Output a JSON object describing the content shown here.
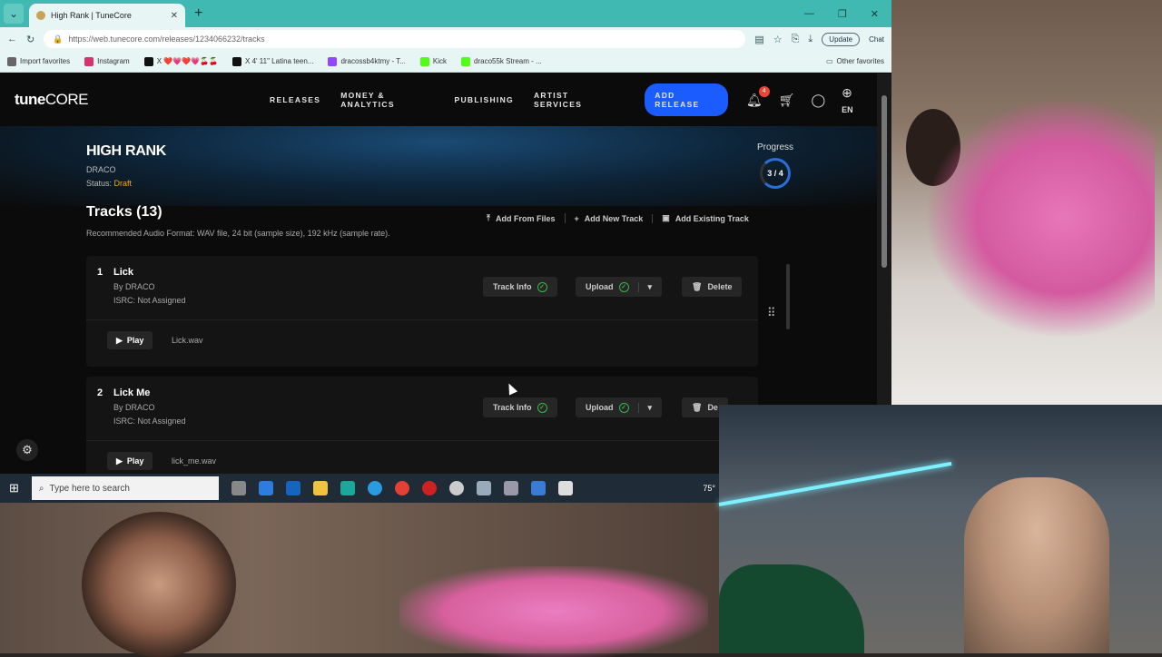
{
  "browser": {
    "tab_title": "High Rank | TuneCore",
    "url": "https://web.tunecore.com/releases/1234066232/tracks",
    "update_label": "Update",
    "chat_label": "Chat",
    "bookmarks": [
      {
        "label": "Import favorites",
        "color": "#666666"
      },
      {
        "label": "Instagram",
        "color": "#d6336c"
      },
      {
        "label": "X ❤️💗❤️💗🍒🍒",
        "color": "#111111"
      },
      {
        "label": "X 4' 11\" Latina teen...",
        "color": "#111111"
      },
      {
        "label": "dracossb4ktmy - T...",
        "color": "#9146ff"
      },
      {
        "label": "Kick",
        "color": "#53fc18"
      },
      {
        "label": "draco55k Stream - ...",
        "color": "#53fc18"
      }
    ],
    "other_favorites": "Other favorites"
  },
  "site": {
    "logo_bold": "tune",
    "logo_rest": "CORE",
    "nav": [
      "RELEASES",
      "MONEY & ANALYTICS",
      "PUBLISHING",
      "ARTIST SERVICES"
    ],
    "add_release": "ADD RELEASE",
    "notif_count": "4",
    "lang": "EN",
    "accent": "#1a5cff"
  },
  "release": {
    "title": "HIGH RANK",
    "artist": "DRACO",
    "status_label": "Status:",
    "status_value": "Draft",
    "progress_label": "Progress",
    "progress_value": "3 / 4"
  },
  "tracks": {
    "heading": "Tracks (13)",
    "recommendation": "Recommended Audio Format: WAV file, 24 bit (sample size), 192 kHz (sample rate).",
    "add_from_files": "Add From Files",
    "add_new_track": "Add New Track",
    "add_existing_track": "Add Existing Track",
    "items": [
      {
        "num": "1",
        "name": "Lick",
        "by": "By DRACO",
        "isrc": "ISRC: Not Assigned",
        "file": "Lick.wav"
      },
      {
        "num": "2",
        "name": "Lick Me",
        "by": "By DRACO",
        "isrc": "ISRC: Not Assigned",
        "file": "lick_me.wav"
      }
    ],
    "track_info": "Track Info",
    "upload": "Upload",
    "delete": "Delete",
    "delete_partial": "De",
    "play": "Play"
  },
  "taskbar": {
    "search_placeholder": "Type here to search",
    "temp": "75°"
  }
}
